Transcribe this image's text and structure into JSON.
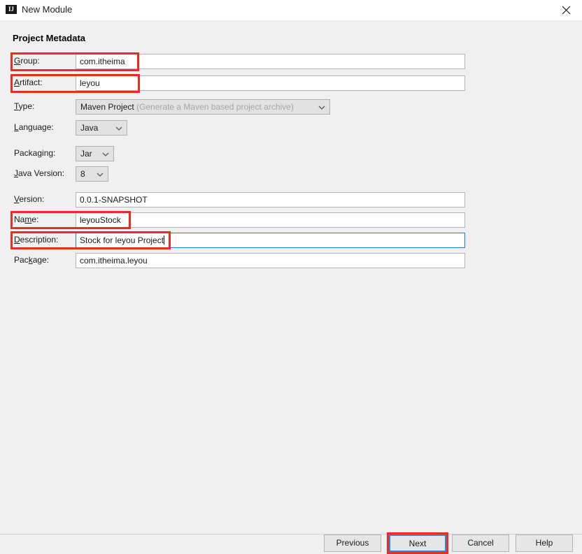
{
  "window": {
    "title": "New Module",
    "icon": "intellij-idea-icon",
    "close_icon": "close-icon"
  },
  "page": {
    "heading": "Project Metadata"
  },
  "form": {
    "fields": [
      {
        "key": "group",
        "label": "Group:",
        "mnemonic": "G",
        "label_prefix": "",
        "label_suffix": "roup:",
        "value": "com.itheima",
        "type": "text",
        "focused": false,
        "highlighted": true
      },
      {
        "key": "artifact",
        "label": "Artifact:",
        "mnemonic": "A",
        "label_prefix": "",
        "label_suffix": "rtifact:",
        "value": "leyou",
        "type": "text",
        "focused": false,
        "highlighted": true
      },
      {
        "key": "type",
        "label": "Type:",
        "mnemonic": "T",
        "label_prefix": "",
        "label_suffix": "ype:",
        "value": "Maven Project",
        "hint": "(Generate a Maven based project archive)",
        "type": "combo",
        "focused": false,
        "highlighted": false
      },
      {
        "key": "language",
        "label": "Language:",
        "mnemonic": "L",
        "label_prefix": "",
        "label_suffix": "anguage:",
        "value": "Java",
        "type": "combo",
        "focused": false,
        "highlighted": false
      },
      {
        "key": "packaging",
        "label": "Packaging:",
        "mnemonic": "g",
        "label_prefix": "Packa",
        "label_suffix": "ing:",
        "value": "Jar",
        "type": "combo",
        "focused": false,
        "highlighted": false
      },
      {
        "key": "java_version",
        "label": "Java Version:",
        "mnemonic": "J",
        "label_prefix": "",
        "label_suffix": "ava Version:",
        "value": "8",
        "type": "combo",
        "focused": false,
        "highlighted": false
      },
      {
        "key": "version",
        "label": "Version:",
        "mnemonic": "V",
        "label_prefix": "",
        "label_suffix": "ersion:",
        "value": "0.0.1-SNAPSHOT",
        "type": "text",
        "focused": false,
        "highlighted": false
      },
      {
        "key": "name",
        "label": "Name:",
        "mnemonic": "m",
        "label_prefix": "Na",
        "label_suffix": "e:",
        "value": "leyouStock",
        "type": "text",
        "focused": false,
        "highlighted": true
      },
      {
        "key": "description",
        "label": "Description:",
        "mnemonic": "D",
        "label_prefix": "",
        "label_suffix": "escription:",
        "value": "Stock for leyou Project",
        "type": "text",
        "focused": true,
        "highlighted": true
      },
      {
        "key": "package",
        "label": "Package:",
        "mnemonic": "k",
        "label_prefix": "Pac",
        "label_suffix": "age:",
        "value": "com.itheima.leyou",
        "type": "text",
        "focused": false,
        "highlighted": false
      }
    ]
  },
  "footer": {
    "buttons": [
      {
        "key": "previous",
        "label": "Previous",
        "focused": false,
        "highlighted": false
      },
      {
        "key": "next",
        "label": "Next",
        "focused": true,
        "highlighted": true
      },
      {
        "key": "cancel",
        "label": "Cancel",
        "focused": false,
        "highlighted": false
      },
      {
        "key": "help",
        "label": "Help",
        "focused": false,
        "highlighted": false
      }
    ]
  },
  "colors": {
    "annotation": "#ee2b21",
    "focus": "#1d7bd3",
    "window_bg": "#f0f0f0",
    "titlebar_bg": "#ffffff",
    "field_bg": "#ffffff",
    "combo_bg": "#e2e2e2",
    "button_bg": "#e6e6e6"
  }
}
